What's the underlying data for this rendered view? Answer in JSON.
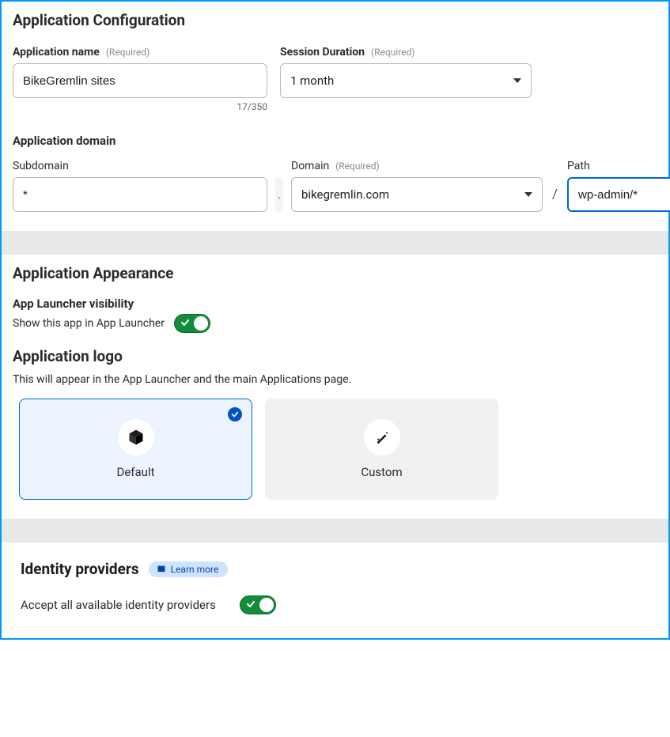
{
  "config": {
    "title": "Application Configuration",
    "name_label": "Application name",
    "required_hint": "(Required)",
    "name_value": "BikeGremlin sites",
    "name_counter": "17/350",
    "session_label": "Session Duration",
    "session_value": "1 month",
    "domain_heading": "Application domain",
    "subdomain_label": "Subdomain",
    "subdomain_value": "*",
    "dot_sep": ".",
    "domain_label": "Domain",
    "domain_value": "bikegremlin.com",
    "slash_sep": "/",
    "path_label": "Path",
    "path_value": "wp-admin/*"
  },
  "appearance": {
    "title": "Application Appearance",
    "launcher_head": "App Launcher visibility",
    "launcher_text": "Show this app in App Launcher",
    "logo_title": "Application logo",
    "logo_desc": "This will appear in the App Launcher and the main Applications page.",
    "option_default": "Default",
    "option_custom": "Custom"
  },
  "identity": {
    "title": "Identity providers",
    "learn_more": "Learn more",
    "accept_text": "Accept all available identity providers"
  }
}
